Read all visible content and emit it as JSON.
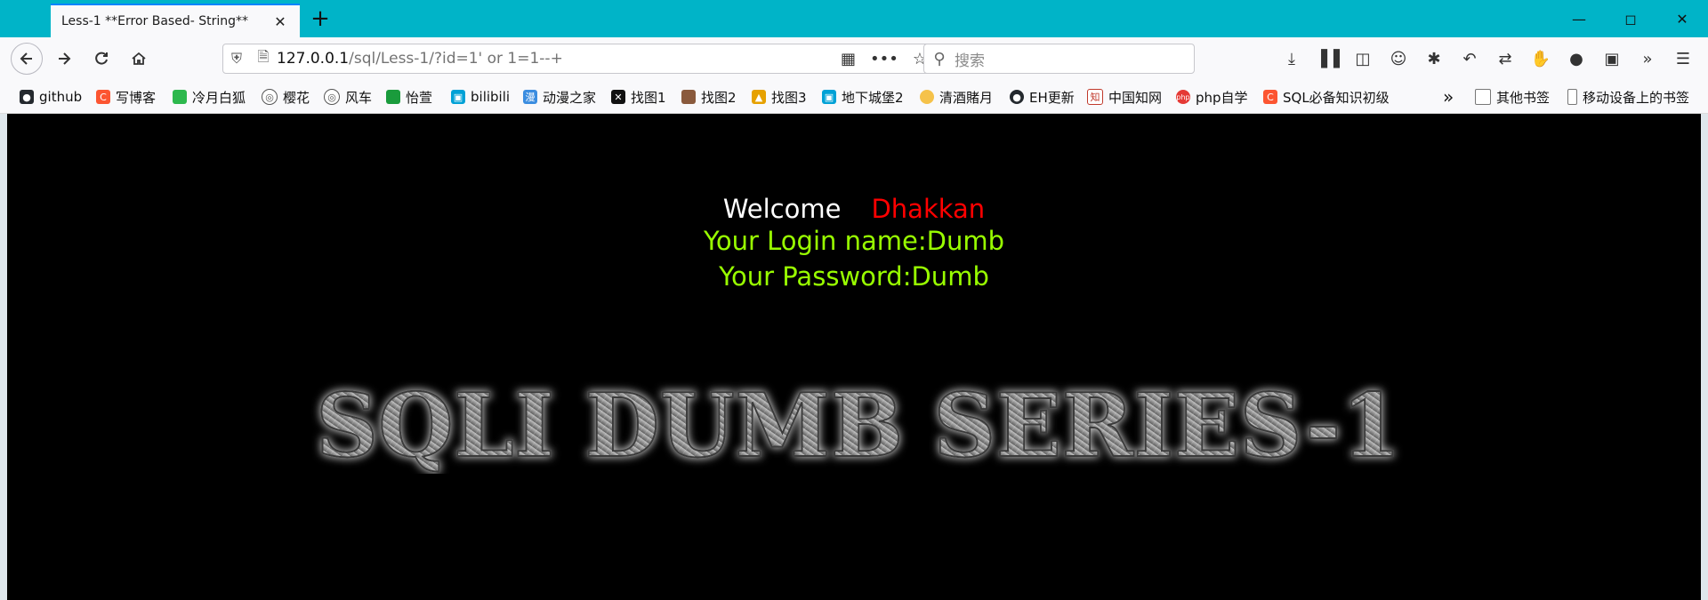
{
  "window": {
    "tab_title": "Less-1 **Error Based- String**",
    "controls": [
      "minimize",
      "maximize",
      "close"
    ]
  },
  "navbar": {
    "url_host": "127.0.0.1",
    "url_path": "/sql/Less-1/?id=1' or 1=1--+",
    "search_placeholder": "搜索"
  },
  "bookmarks": [
    {
      "label": "github",
      "icon": "github-icon",
      "color": "#24292e"
    },
    {
      "label": "写博客",
      "icon": "csdn-icon",
      "color": "#fc5531"
    },
    {
      "label": "冷月白狐",
      "icon": "leaf-icon",
      "color": "#2db84d"
    },
    {
      "label": "樱花",
      "icon": "globe-icon",
      "color": "#555555"
    },
    {
      "label": "风车",
      "icon": "globe-icon",
      "color": "#555555"
    },
    {
      "label": "怡萱",
      "icon": "leaf-icon",
      "color": "#1a9b3c"
    },
    {
      "label": "bilibili",
      "icon": "bilibili-icon",
      "color": "#00a1d6"
    },
    {
      "label": "动漫之家",
      "icon": "dmzj-icon",
      "color": "#3b8de0"
    },
    {
      "label": "找图1",
      "icon": "x-icon",
      "color": "#111111"
    },
    {
      "label": "找图2",
      "icon": "avatar-icon",
      "color": "#8a5a3c"
    },
    {
      "label": "找图3",
      "icon": "image-icon",
      "color": "#e6a100"
    },
    {
      "label": "地下城堡2",
      "icon": "bilibili-icon",
      "color": "#00a1d6"
    },
    {
      "label": "清酒賭月",
      "icon": "moon-icon",
      "color": "#f5c24a"
    },
    {
      "label": "EH更新",
      "icon": "github-icon",
      "color": "#24292e"
    },
    {
      "label": "中国知网",
      "icon": "cnki-icon",
      "color": "#c0392b"
    },
    {
      "label": "php自学",
      "icon": "php-icon",
      "color": "#e53935"
    },
    {
      "label": "SQL必备知识初级",
      "icon": "csdn-icon",
      "color": "#fc5531"
    }
  ],
  "bookmarks_right": [
    {
      "label": "其他书签",
      "icon": "folder-icon"
    },
    {
      "label": "移动设备上的书签",
      "icon": "phone-icon"
    }
  ],
  "page": {
    "welcome_label": "Welcome",
    "username": "Dhakkan",
    "login_line": "Your Login name:Dumb",
    "password_line": "Your Password:Dumb",
    "banner": "SQLI DUMB SERIES-1",
    "colors": {
      "background": "#000000",
      "welcome": "#ffffff",
      "username": "#ff0000",
      "info": "#99ff00"
    }
  }
}
